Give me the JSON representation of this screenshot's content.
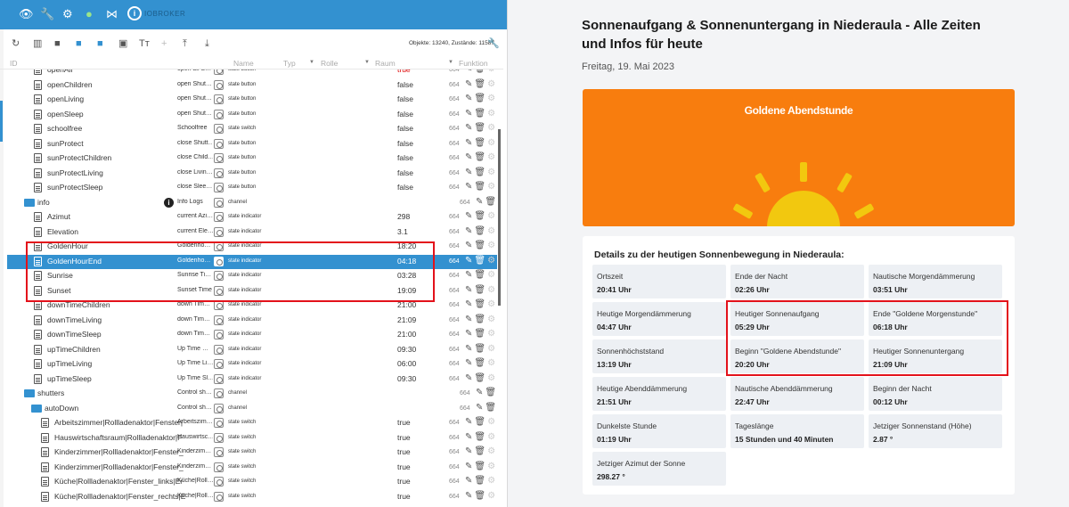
{
  "appbar": {
    "logo_text": "IOBROKER",
    "logo_letter": "i"
  },
  "toolbar": {
    "stats": "Objekte: 13240, Zustände: 11587"
  },
  "columns": {
    "id": "ID",
    "name": "Name",
    "typ": "Typ",
    "rolle": "Rolle",
    "raum": "Raum",
    "funktion": "Funktion"
  },
  "tree": [
    {
      "name": "openAll",
      "desc": "open all S…",
      "role": "state button",
      "value": "true",
      "acl": "664",
      "indent": 38,
      "type": "state",
      "red": true
    },
    {
      "name": "openChildren",
      "desc": "open Shut…",
      "role": "state button",
      "value": "false",
      "acl": "664",
      "indent": 38,
      "type": "state"
    },
    {
      "name": "openLiving",
      "desc": "open Shut…",
      "role": "state button",
      "value": "false",
      "acl": "664",
      "indent": 38,
      "type": "state"
    },
    {
      "name": "openSleep",
      "desc": "open Shut…",
      "role": "state button",
      "value": "false",
      "acl": "664",
      "indent": 38,
      "type": "state"
    },
    {
      "name": "schoolfree",
      "desc": "Schoolfree",
      "role": "state switch",
      "value": "false",
      "acl": "664",
      "indent": 38,
      "type": "state"
    },
    {
      "name": "sunProtect",
      "desc": "close Shutt…",
      "role": "state button",
      "value": "false",
      "acl": "664",
      "indent": 38,
      "type": "state"
    },
    {
      "name": "sunProtectChildren",
      "desc": "close Child…",
      "role": "state button",
      "value": "false",
      "acl": "664",
      "indent": 38,
      "type": "state"
    },
    {
      "name": "sunProtectLiving",
      "desc": "close Livin…",
      "role": "state button",
      "value": "false",
      "acl": "664",
      "indent": 38,
      "type": "state"
    },
    {
      "name": "sunProtectSleep",
      "desc": "close Slee…",
      "role": "state button",
      "value": "false",
      "acl": "664",
      "indent": 38,
      "type": "state"
    },
    {
      "name": "info",
      "desc": "Info Logs",
      "role": "channel",
      "value": "",
      "acl": "664",
      "indent": 27,
      "type": "folder",
      "info": true
    },
    {
      "name": "Azimut",
      "desc": "current Azi…",
      "role": "state indicator",
      "value": "298",
      "acl": "664",
      "indent": 38,
      "type": "state"
    },
    {
      "name": "Elevation",
      "desc": "current Ele…",
      "role": "state indicator",
      "value": "3.1",
      "acl": "664",
      "indent": 38,
      "type": "state"
    },
    {
      "name": "GoldenHour",
      "desc": "Goldenho…",
      "role": "state indicator",
      "value": "18:20",
      "acl": "664",
      "indent": 38,
      "type": "state"
    },
    {
      "name": "GoldenHourEnd",
      "desc": "Goldenho…",
      "role": "state indicator",
      "value": "04:18",
      "acl": "664",
      "indent": 38,
      "type": "state",
      "selected": true
    },
    {
      "name": "Sunrise",
      "desc": "Sunrise Ti…",
      "role": "state indicator",
      "value": "03:28",
      "acl": "664",
      "indent": 38,
      "type": "state"
    },
    {
      "name": "Sunset",
      "desc": "Sunset Time",
      "role": "state indicator",
      "value": "19:09",
      "acl": "664",
      "indent": 38,
      "type": "state"
    },
    {
      "name": "downTimeChildren",
      "desc": "down Tim…",
      "role": "state indicator",
      "value": "21:00",
      "acl": "664",
      "indent": 38,
      "type": "state"
    },
    {
      "name": "downTimeLiving",
      "desc": "down Tim…",
      "role": "state indicator",
      "value": "21:09",
      "acl": "664",
      "indent": 38,
      "type": "state"
    },
    {
      "name": "downTimeSleep",
      "desc": "down Tim…",
      "role": "state indicator",
      "value": "21:00",
      "acl": "664",
      "indent": 38,
      "type": "state"
    },
    {
      "name": "upTimeChildren",
      "desc": "Up Time …",
      "role": "state indicator",
      "value": "09:30",
      "acl": "664",
      "indent": 38,
      "type": "state"
    },
    {
      "name": "upTimeLiving",
      "desc": "Up Time Li…",
      "role": "state indicator",
      "value": "06:00",
      "acl": "664",
      "indent": 38,
      "type": "state"
    },
    {
      "name": "upTimeSleep",
      "desc": "Up Time Sl…",
      "role": "state indicator",
      "value": "09:30",
      "acl": "664",
      "indent": 38,
      "type": "state"
    },
    {
      "name": "shutters",
      "desc": "Control sh…",
      "role": "channel",
      "value": "",
      "acl": "664",
      "indent": 27,
      "type": "folder"
    },
    {
      "name": "autoDown",
      "desc": "Control sh…",
      "role": "channel",
      "value": "",
      "acl": "664",
      "indent": 35,
      "type": "folder"
    },
    {
      "name": "Arbeitszimmer|Rollladenaktor|Fenster|",
      "desc": "Arbeitszim…",
      "role": "state switch",
      "value": "true",
      "acl": "664",
      "indent": 46,
      "type": "state"
    },
    {
      "name": "Hauswirtschaftsraum|Rollladenaktor|F",
      "desc": "Hauswirtsc…",
      "role": "state switch",
      "value": "true",
      "acl": "664",
      "indent": 46,
      "type": "state"
    },
    {
      "name": "Kinderzimmer|Rollladenaktor|Fenster_",
      "desc": "Kinderzim…",
      "role": "state switch",
      "value": "true",
      "acl": "664",
      "indent": 46,
      "type": "state"
    },
    {
      "name": "Kinderzimmer|Rollladenaktor|Fenster_",
      "desc": "Kinderzim…",
      "role": "state switch",
      "value": "true",
      "acl": "664",
      "indent": 46,
      "type": "state"
    },
    {
      "name": "Küche|Rollladenaktor|Fenster_links|Er",
      "desc": "Küche|Roll…",
      "role": "state switch",
      "value": "true",
      "acl": "664",
      "indent": 46,
      "type": "state"
    },
    {
      "name": "Küche|Rollladenaktor|Fenster_rechts|E",
      "desc": "Küche|Roll…",
      "role": "state switch",
      "value": "true",
      "acl": "664",
      "indent": 46,
      "type": "state"
    }
  ],
  "article": {
    "title": "Sonnenaufgang & Sonnenuntergang in Niederaula - Alle Zeiten und Infos für heute",
    "date": "Freitag, 19. Mai 2023",
    "banner_title": "Goldene Abendstunde",
    "panel_title": "Details zu der heutigen Sonnenbewegung in Niederaula:",
    "cells": [
      {
        "label": "Ortszeit",
        "value": "20:41 Uhr"
      },
      {
        "label": "Ende der Nacht",
        "value": "02:26 Uhr"
      },
      {
        "label": "Nautische Morgendämmerung",
        "value": "03:51 Uhr"
      },
      {
        "label": "Heutige Morgendämmerung",
        "value": "04:47 Uhr"
      },
      {
        "label": "Heutiger Sonnenaufgang",
        "value": "05:29 Uhr"
      },
      {
        "label": "Ende \"Goldene Morgenstunde\"",
        "value": "06:18 Uhr"
      },
      {
        "label": "Sonnenhöchststand",
        "value": "13:19 Uhr"
      },
      {
        "label": "Beginn \"Goldene Abendstunde\"",
        "value": "20:20 Uhr"
      },
      {
        "label": "Heutiger Sonnenuntergang",
        "value": "21:09 Uhr"
      },
      {
        "label": "Heutige Abenddämmerung",
        "value": "21:51 Uhr"
      },
      {
        "label": "Nautische Abenddämmerung",
        "value": "22:47 Uhr"
      },
      {
        "label": "Beginn der Nacht",
        "value": "00:12 Uhr"
      },
      {
        "label": "Dunkelste Stunde",
        "value": "01:19 Uhr"
      },
      {
        "label": "Tageslänge",
        "value": "15 Stunden und 40 Minuten"
      },
      {
        "label": "Jetziger Sonnenstand (Höhe)",
        "value": "2.87 °"
      },
      {
        "label": "Jetziger Azimut der Sonne",
        "value": "298.27 °"
      }
    ]
  }
}
